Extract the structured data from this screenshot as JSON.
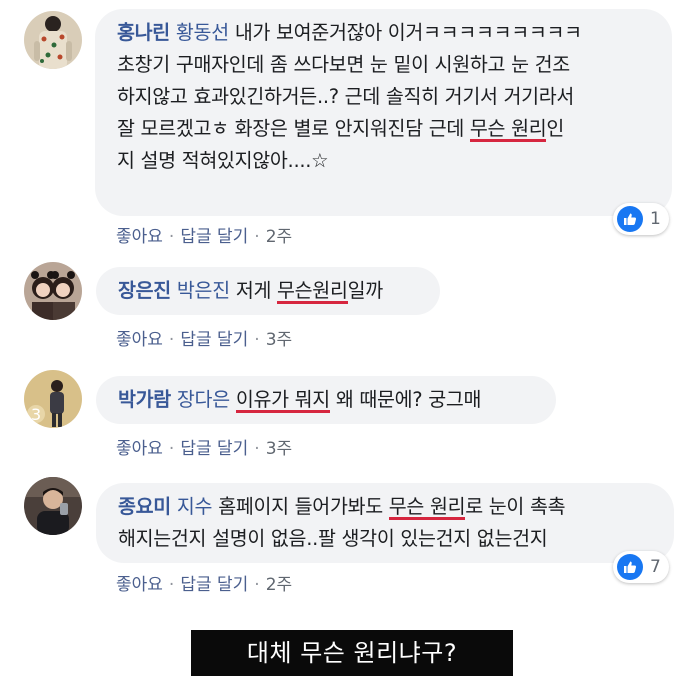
{
  "comments": [
    {
      "author": "홍나린",
      "tag": "황동선",
      "text_parts": [
        "내가 보여준거잖아 이거ㅋㅋㅋㅋㅋㅋㅋㅋㅋ",
        "초창기 구매자인데 좀 쓰다보면 눈 밑이 시원하고 눈 건조",
        "하지않고 효과있긴하거든..? 근데 솔직히 거기서 거기라서",
        "잘 모르겠고ㅎ 화장은 별로 안지워진담 근데 ",
        "무슨 원리",
        "인",
        "지 설명 적혀있지않아....☆"
      ],
      "like_label": "좋아요",
      "reply_label": "답글 달기",
      "time": "2주",
      "reaction_count": "1"
    },
    {
      "author": "장은진",
      "tag": "박은진",
      "text_parts": [
        "저게 ",
        "무슨원리",
        "일까"
      ],
      "like_label": "좋아요",
      "reply_label": "답글 달기",
      "time": "3주"
    },
    {
      "author": "박가람",
      "tag": "장다은",
      "text_parts": [
        "이유가 뭐지",
        " 왜 때문에? 궁그매"
      ],
      "like_label": "좋아요",
      "reply_label": "답글 달기",
      "time": "3주"
    },
    {
      "author": "종요미",
      "tag": "지수",
      "text_parts": [
        "홈페이지 들어가봐도 ",
        "무슨 원리",
        "로 눈이 촉촉",
        "해지는건지 설명이 없음..팔 생각이 있는건지 없는건지"
      ],
      "like_label": "좋아요",
      "reply_label": "답글 달기",
      "time": "2주",
      "reaction_count": "7"
    }
  ],
  "subtitle": "대체 무슨 원리냐구?",
  "colors": {
    "author": "#385898",
    "bubble": "#f2f3f5",
    "highlight": "#d6263f",
    "like_blue": "#1877f2"
  }
}
